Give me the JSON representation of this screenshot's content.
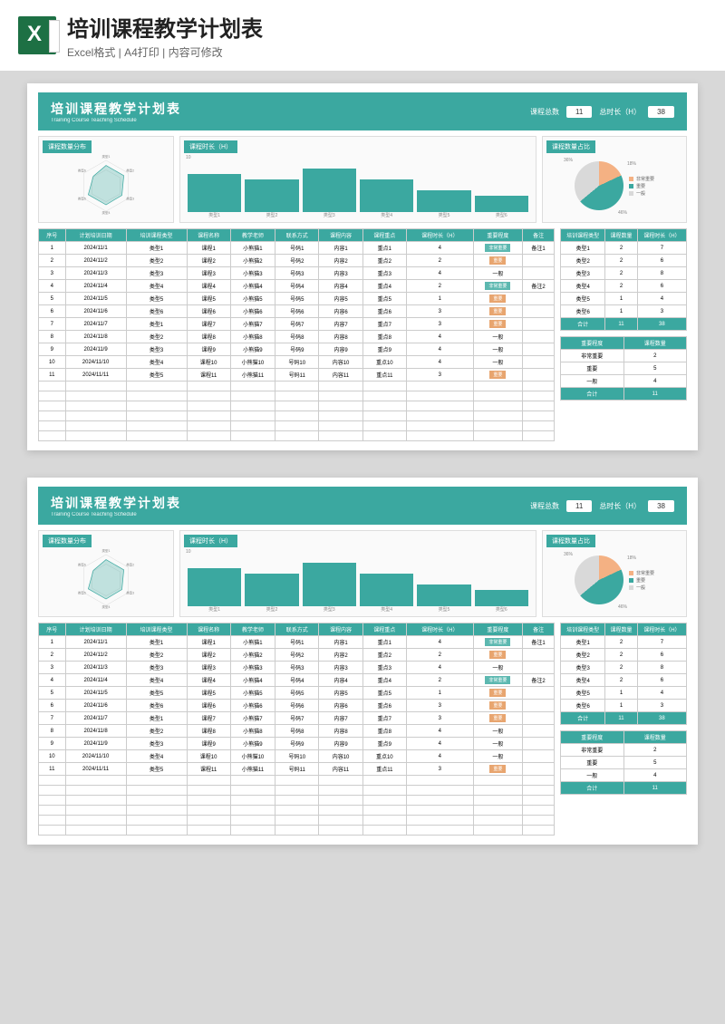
{
  "banner": {
    "title": "培训课程教学计划表",
    "subtitle": "Excel格式 | A4打印 | 内容可修改"
  },
  "doc": {
    "title": "培训课程教学计划表",
    "subtitle": "Training Course Teaching Schedule",
    "stat1_label": "课程总数",
    "stat1_value": "11",
    "stat2_label": "总时长（H）",
    "stat2_value": "38"
  },
  "chart_titles": {
    "radar": "课程数量分布",
    "bar": "课程时长（H）",
    "pie": "课程数量占比"
  },
  "chart_data": [
    {
      "type": "radar",
      "categories": [
        "类型1",
        "类型2",
        "类型3",
        "类型4",
        "类型5",
        "类型6"
      ],
      "values": [
        2,
        2,
        2,
        2,
        2,
        1
      ]
    },
    {
      "type": "bar",
      "categories": [
        "类型1",
        "类型2",
        "类型3",
        "类型4",
        "类型5",
        "类型6"
      ],
      "values": [
        7,
        6,
        8,
        6,
        4,
        3
      ],
      "ylim": [
        0,
        10
      ],
      "ylabel": ""
    },
    {
      "type": "pie",
      "series": [
        {
          "name": "非常重要",
          "value": 18,
          "color": "#f4b183"
        },
        {
          "name": "重要",
          "value": 46,
          "color": "#3ba8a0"
        },
        {
          "name": "一般",
          "value": 36,
          "color": "#d9d9d9"
        }
      ],
      "labels": [
        "36%",
        "18%",
        "46%"
      ]
    }
  ],
  "main_table": {
    "headers": [
      "序号",
      "计划培训日期",
      "培训课程类型",
      "课程名称",
      "教学老师",
      "联系方式",
      "课程内容",
      "课程重点",
      "课程时长（H）",
      "重要程度",
      "备注"
    ],
    "rows": [
      [
        "1",
        "2024/11/1",
        "类型1",
        "课程1",
        "小熊猫1",
        "号码1",
        "内容1",
        "重点1",
        "4",
        "非常重要",
        "备注1"
      ],
      [
        "2",
        "2024/11/2",
        "类型2",
        "课程2",
        "小熊猫2",
        "号码2",
        "内容2",
        "重点2",
        "2",
        "重要",
        ""
      ],
      [
        "3",
        "2024/11/3",
        "类型3",
        "课程3",
        "小熊猫3",
        "号码3",
        "内容3",
        "重点3",
        "4",
        "一般",
        ""
      ],
      [
        "4",
        "2024/11/4",
        "类型4",
        "课程4",
        "小熊猫4",
        "号码4",
        "内容4",
        "重点4",
        "2",
        "非常重要",
        "备注2"
      ],
      [
        "5",
        "2024/11/5",
        "类型5",
        "课程5",
        "小熊猫5",
        "号码5",
        "内容5",
        "重点5",
        "1",
        "重要",
        ""
      ],
      [
        "6",
        "2024/11/6",
        "类型6",
        "课程6",
        "小熊猫6",
        "号码6",
        "内容6",
        "重点6",
        "3",
        "重要",
        ""
      ],
      [
        "7",
        "2024/11/7",
        "类型1",
        "课程7",
        "小熊猫7",
        "号码7",
        "内容7",
        "重点7",
        "3",
        "重要",
        ""
      ],
      [
        "8",
        "2024/11/8",
        "类型2",
        "课程8",
        "小熊猫8",
        "号码8",
        "内容8",
        "重点8",
        "4",
        "一般",
        ""
      ],
      [
        "9",
        "2024/11/9",
        "类型3",
        "课程9",
        "小熊猫9",
        "号码9",
        "内容9",
        "重点9",
        "4",
        "一般",
        ""
      ],
      [
        "10",
        "2024/11/10",
        "类型4",
        "课程10",
        "小熊猫10",
        "号码10",
        "内容10",
        "重点10",
        "4",
        "一般",
        ""
      ],
      [
        "11",
        "2024/11/11",
        "类型5",
        "课程11",
        "小熊猫11",
        "号码11",
        "内容11",
        "重点11",
        "3",
        "重要",
        ""
      ]
    ]
  },
  "summary1": {
    "headers": [
      "培训课程类型",
      "课程数量",
      "课程时长（H）"
    ],
    "rows": [
      [
        "类型1",
        "2",
        "7"
      ],
      [
        "类型2",
        "2",
        "6"
      ],
      [
        "类型3",
        "2",
        "8"
      ],
      [
        "类型4",
        "2",
        "6"
      ],
      [
        "类型5",
        "1",
        "4"
      ],
      [
        "类型6",
        "1",
        "3"
      ]
    ],
    "total": [
      "合计",
      "11",
      "38"
    ]
  },
  "summary2": {
    "headers": [
      "重要程度",
      "课程数量"
    ],
    "rows": [
      [
        "非常重要",
        "2"
      ],
      [
        "重要",
        "5"
      ],
      [
        "一般",
        "4"
      ]
    ],
    "total": [
      "合计",
      "11"
    ]
  },
  "colors": {
    "teal": "#3ba8a0",
    "orange": "#e8a56f"
  }
}
